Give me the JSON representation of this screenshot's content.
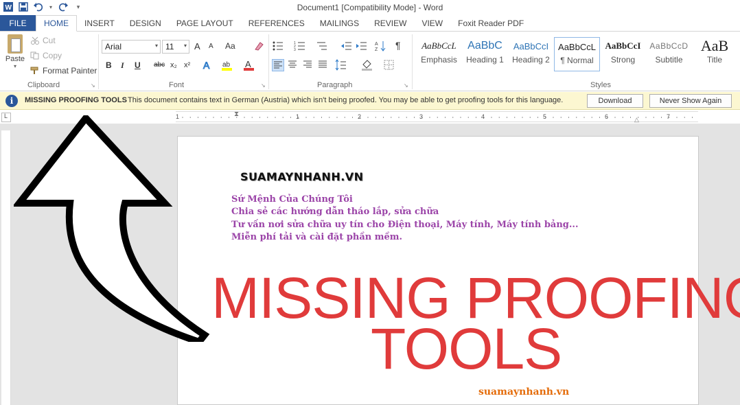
{
  "window": {
    "title": "Document1 [Compatibility Mode] - Word",
    "quick_access": [
      "word-icon",
      "save-icon",
      "undo-icon",
      "redo-icon",
      "customize-icon"
    ]
  },
  "tabs": [
    {
      "label": "FILE"
    },
    {
      "label": "HOME"
    },
    {
      "label": "INSERT"
    },
    {
      "label": "DESIGN"
    },
    {
      "label": "PAGE LAYOUT"
    },
    {
      "label": "REFERENCES"
    },
    {
      "label": "MAILINGS"
    },
    {
      "label": "REVIEW"
    },
    {
      "label": "VIEW"
    },
    {
      "label": "Foxit Reader PDF"
    }
  ],
  "ribbon": {
    "clipboard": {
      "paste": "Paste",
      "cut": "Cut",
      "copy": "Copy",
      "format_painter": "Format Painter",
      "label": "Clipboard"
    },
    "font": {
      "font_name": "Arial",
      "font_size": "11",
      "grow": "A",
      "shrink": "A",
      "change_case": "Aa",
      "bold": "B",
      "italic": "I",
      "underline": "U",
      "strike": "abc",
      "subscript": "x₂",
      "superscript": "x²",
      "label": "Font"
    },
    "paragraph": {
      "label": "Paragraph"
    },
    "styles": {
      "label": "Styles",
      "items": [
        {
          "preview": "AaBbCcL",
          "name": "Emphasis"
        },
        {
          "preview": "AaBbC",
          "name": "Heading 1"
        },
        {
          "preview": "AaBbCcI",
          "name": "Heading 2"
        },
        {
          "preview": "AaBbCcL",
          "name": "¶ Normal"
        },
        {
          "preview": "AaBbCcI",
          "name": "Strong"
        },
        {
          "preview": "AaBbCcD",
          "name": "Subtitle"
        },
        {
          "preview": "AaB",
          "name": "Title"
        }
      ],
      "selected": "¶ Normal"
    }
  },
  "message_bar": {
    "title": "MISSING PROOFING TOOLS",
    "text": "This document contains text in German (Austria) which isn't being proofed. You may be able to get proofing tools for this language.",
    "download": "Download",
    "never_show": "Never Show Again"
  },
  "ruler": {
    "numbers": [
      "1",
      "1",
      "2",
      "3",
      "4",
      "5",
      "6",
      "7"
    ]
  },
  "document": {
    "brand": "SUAMAYNHANH.VN",
    "lines": [
      "Sứ Mệnh Của Chúng Tôi",
      "Chia sẻ các hướng dẫn tháo lắp, sửa chữa",
      "Tư vấn nơi sửa chữa uy tín cho Điện thoại, Máy tính, Máy tính bảng...",
      "Miễn phí tải và cài đặt phần mềm."
    ],
    "headline_line1": "MISSING PROOFING",
    "headline_line2": "TOOLS",
    "footer_url": "suamaynhanh.vn"
  },
  "colors": {
    "accent": "#2b579a",
    "message_bg": "#fcf7d1",
    "headline": "#e03b3b",
    "mission_text": "#9b44a8",
    "footer_url": "#e46c0a"
  }
}
